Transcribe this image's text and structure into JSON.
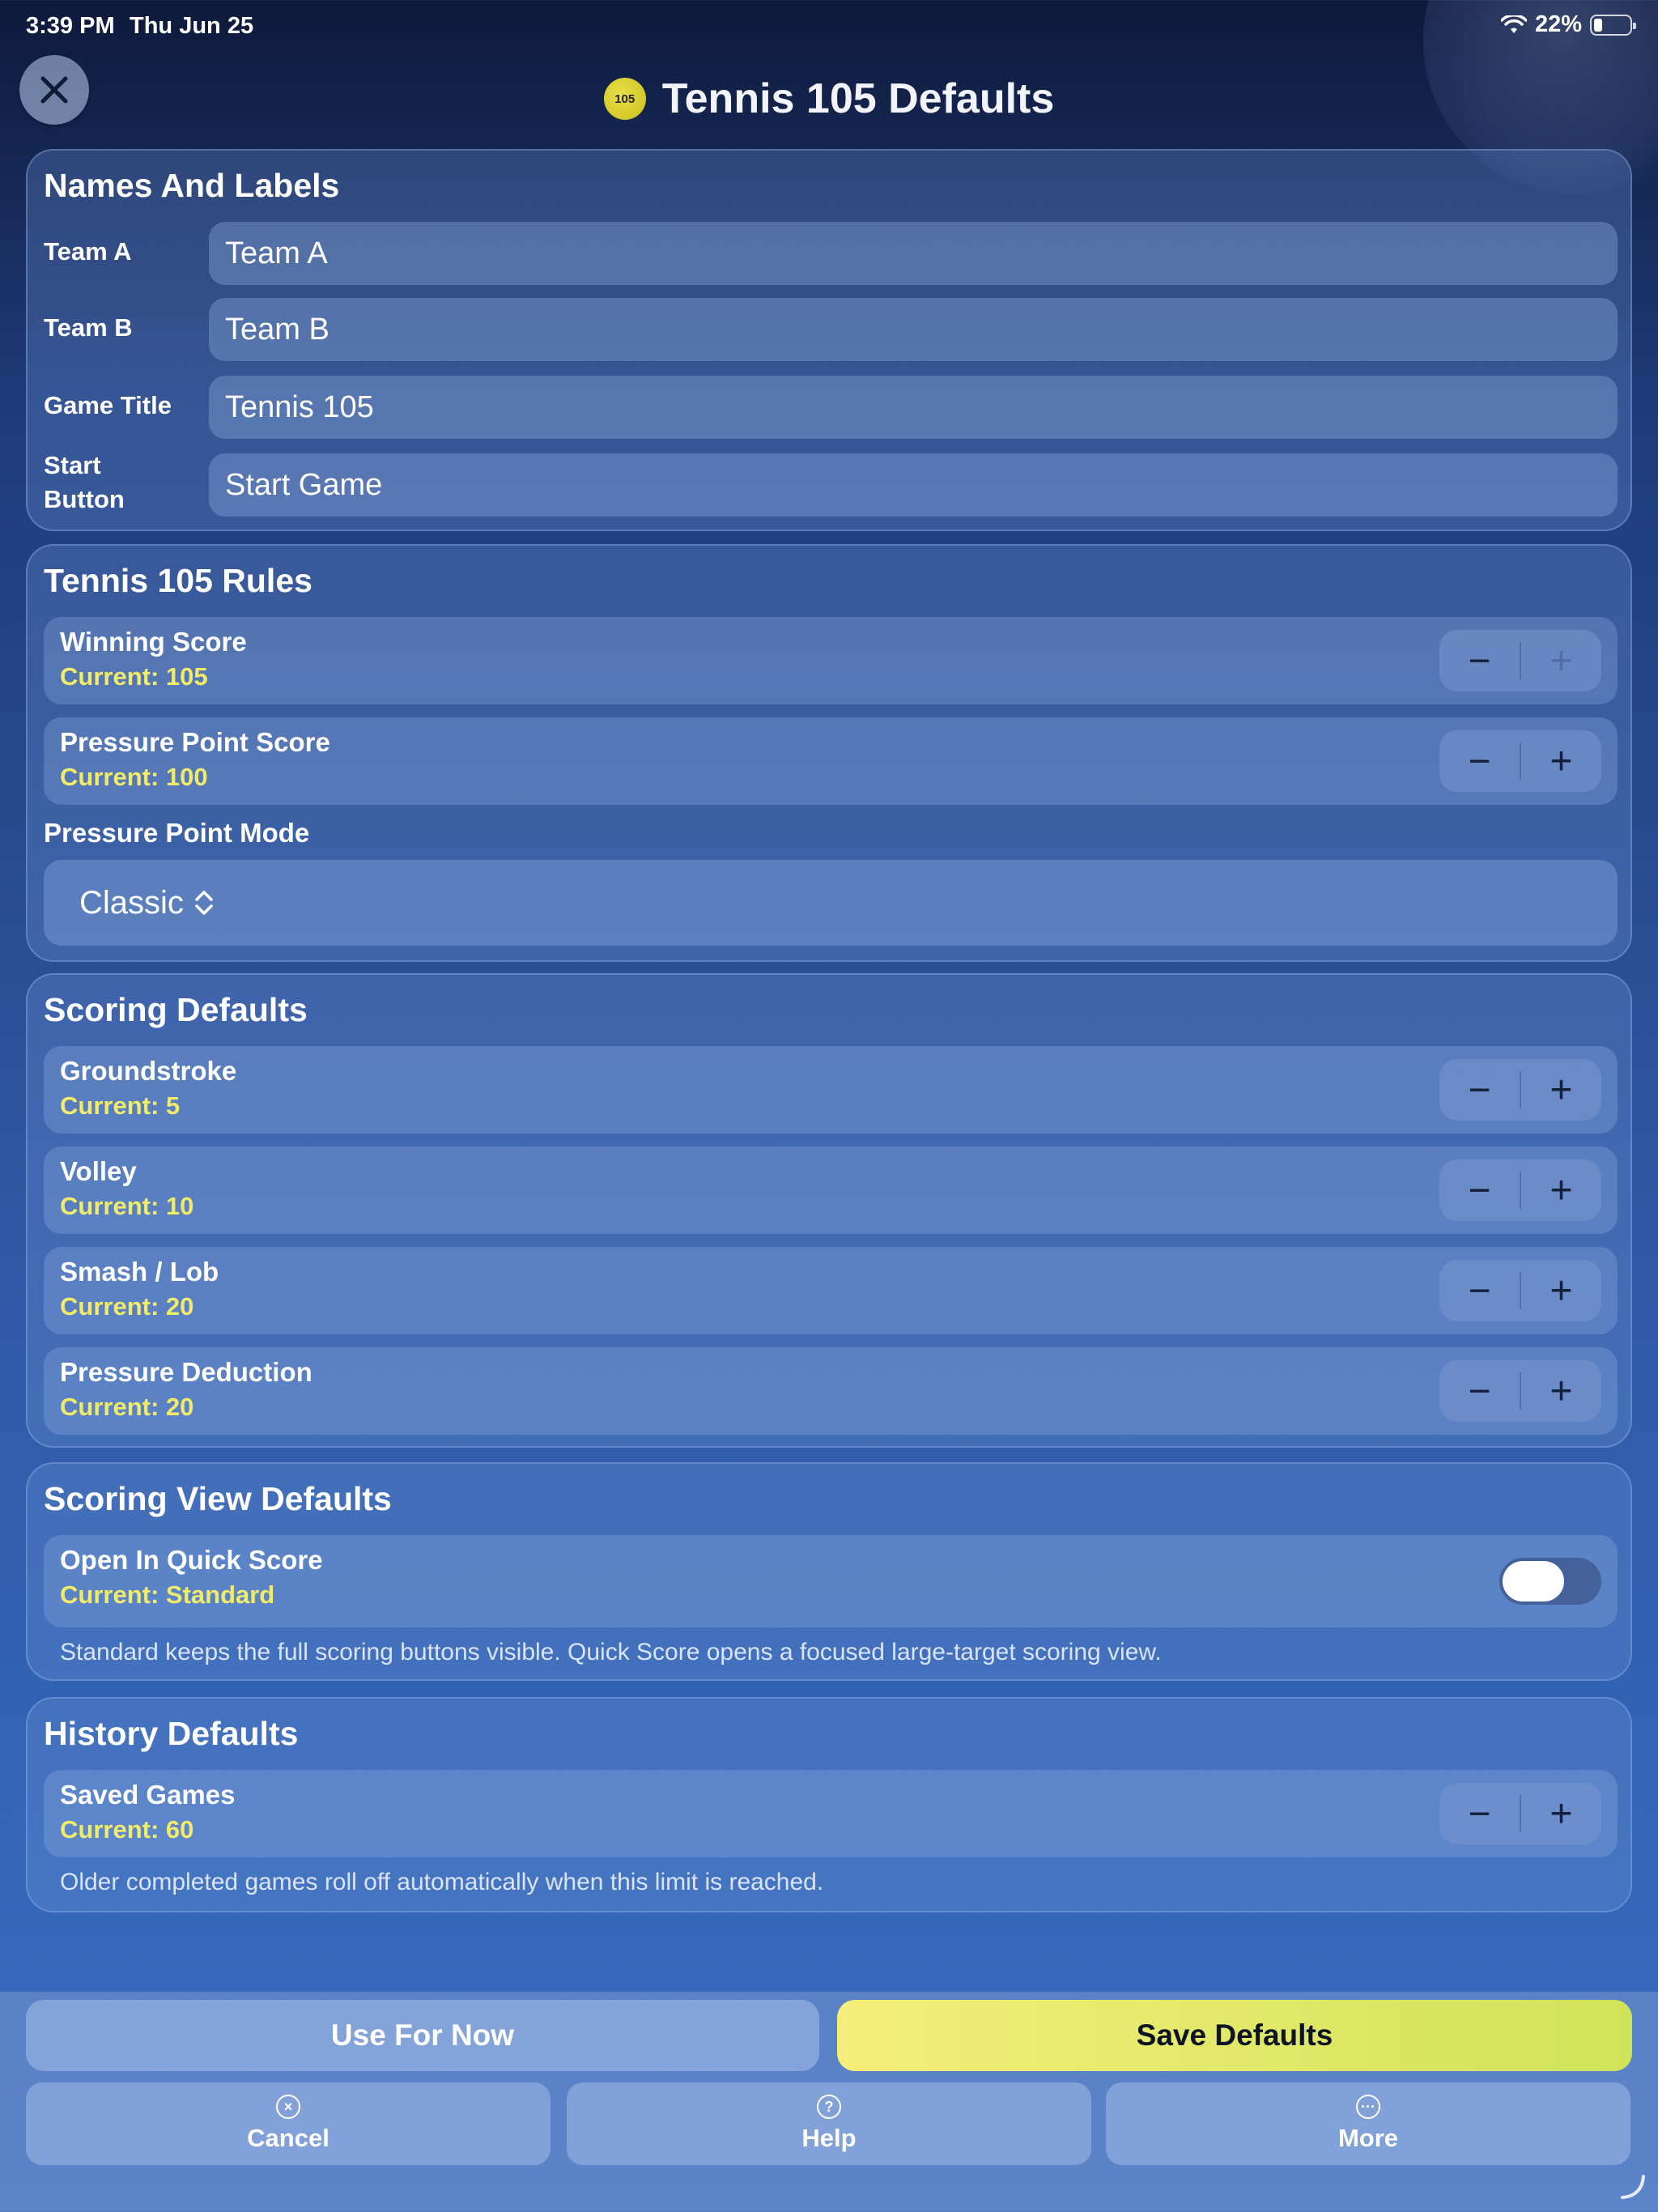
{
  "status_bar": {
    "time": "3:39 PM",
    "date": "Thu Jun 25",
    "battery": "22%"
  },
  "header": {
    "title": "Tennis 105 Defaults",
    "logo_text": "105"
  },
  "names_and_labels": {
    "title": "Names And Labels",
    "fields": [
      {
        "label": "Team A",
        "value": "Team A"
      },
      {
        "label": "Team B",
        "value": "Team B"
      },
      {
        "label": "Game Title",
        "value": "Tennis 105"
      },
      {
        "label_line1": "Start",
        "label_line2": "Button",
        "value": "Start Game"
      }
    ]
  },
  "rules": {
    "title": "Tennis 105 Rules",
    "rows": [
      {
        "label": "Winning Score",
        "current": "Current: 105"
      },
      {
        "label": "Pressure Point Score",
        "current": "Current: 100"
      }
    ],
    "mode_label": "Pressure Point Mode",
    "mode_value": "Classic"
  },
  "scoring": {
    "title": "Scoring Defaults",
    "rows": [
      {
        "label": "Groundstroke",
        "current": "Current: 5"
      },
      {
        "label": "Volley",
        "current": "Current: 10"
      },
      {
        "label": "Smash / Lob",
        "current": "Current: 20"
      },
      {
        "label": "Pressure Deduction",
        "current": "Current: 20"
      }
    ]
  },
  "scoring_view": {
    "title": "Scoring View Defaults",
    "row_label": "Open In Quick Score",
    "current": "Current: Standard",
    "toggle_on": false,
    "help": "Standard keeps the full scoring buttons visible. Quick Score opens a focused large-target scoring view."
  },
  "history": {
    "title": "History Defaults",
    "row_label": "Saved Games",
    "current": "Current: 60",
    "help": "Older completed games roll off automatically when this limit is reached."
  },
  "stepper": {
    "minus": "−",
    "plus": "+"
  },
  "actions": {
    "use_for_now": "Use For Now",
    "save_defaults": "Save Defaults",
    "cancel": "Cancel",
    "help": "Help",
    "more": "More"
  }
}
